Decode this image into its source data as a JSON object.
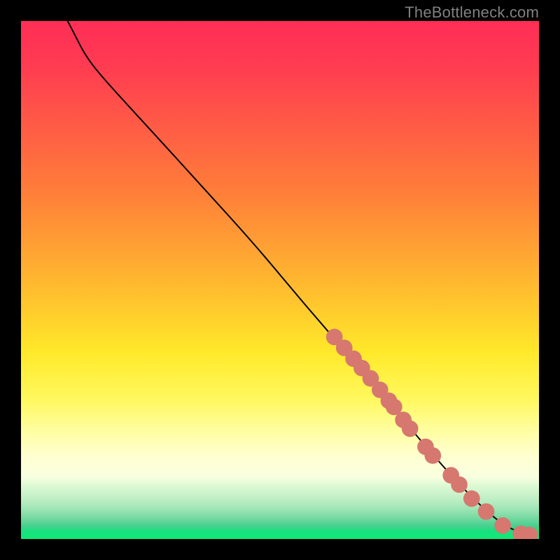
{
  "watermark": {
    "text": "TheBottleneck.com"
  },
  "colors": {
    "background": "#000000",
    "curve": "#000000",
    "dot": "#d6786f",
    "watermark": "#808080",
    "gradient_top": "#ff2e56",
    "gradient_mid_orange": "#ffa233",
    "gradient_mid_yellow": "#ffe92a",
    "gradient_bottom": "#10e878"
  },
  "chart_data": {
    "type": "line",
    "title": "",
    "xlabel": "",
    "ylabel": "",
    "xlim": [
      0,
      100
    ],
    "ylim": [
      0,
      100
    ],
    "note": "No axes/ticks are shown in the image. x and y are normalized 0–100 inside the colored plot area (origin top-left: y=0 is top, y=100 is bottom). The curve descends from top-left toward bottom-right. Points are small markers clustered along the lower-right segment of the curve.",
    "curve": [
      {
        "x": 9.0,
        "y": 0.0
      },
      {
        "x": 10.2,
        "y": 2.3
      },
      {
        "x": 12.5,
        "y": 6.8
      },
      {
        "x": 15.8,
        "y": 11.0
      },
      {
        "x": 25.0,
        "y": 21.0
      },
      {
        "x": 35.0,
        "y": 32.0
      },
      {
        "x": 45.0,
        "y": 43.0
      },
      {
        "x": 55.0,
        "y": 55.0
      },
      {
        "x": 65.0,
        "y": 66.5
      },
      {
        "x": 75.0,
        "y": 78.5
      },
      {
        "x": 85.0,
        "y": 90.0
      },
      {
        "x": 93.0,
        "y": 97.5
      },
      {
        "x": 98.0,
        "y": 99.2
      }
    ],
    "points": [
      {
        "x": 60.5,
        "y": 61.0
      },
      {
        "x": 62.4,
        "y": 63.1
      },
      {
        "x": 64.2,
        "y": 65.2
      },
      {
        "x": 65.8,
        "y": 67.0
      },
      {
        "x": 67.5,
        "y": 69.0
      },
      {
        "x": 69.3,
        "y": 71.2
      },
      {
        "x": 71.0,
        "y": 73.3
      },
      {
        "x": 72.0,
        "y": 74.5
      },
      {
        "x": 73.8,
        "y": 77.0
      },
      {
        "x": 75.1,
        "y": 78.7
      },
      {
        "x": 78.1,
        "y": 82.2
      },
      {
        "x": 79.5,
        "y": 83.9
      },
      {
        "x": 83.0,
        "y": 87.7
      },
      {
        "x": 84.6,
        "y": 89.5
      },
      {
        "x": 87.0,
        "y": 92.2
      },
      {
        "x": 89.8,
        "y": 94.7
      },
      {
        "x": 93.0,
        "y": 97.4
      },
      {
        "x": 96.5,
        "y": 99.0
      },
      {
        "x": 98.2,
        "y": 99.2
      }
    ],
    "dot_radius": 1.6
  }
}
